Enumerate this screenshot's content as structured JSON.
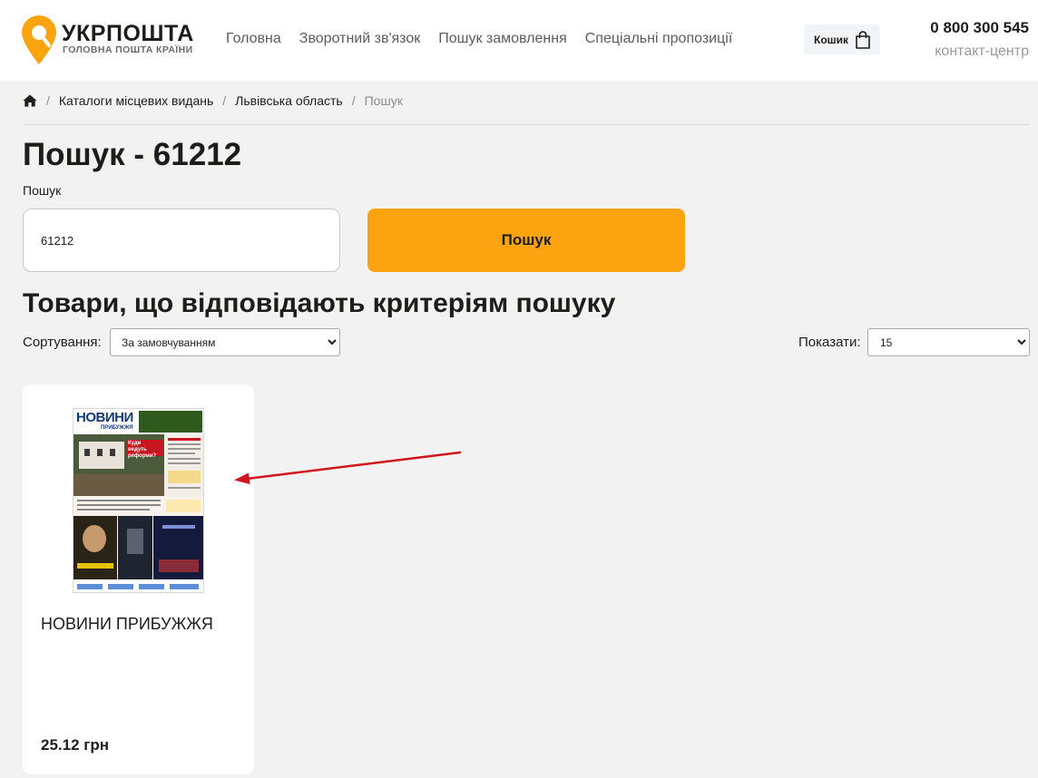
{
  "header": {
    "logo": {
      "title": "УКРПОШТА",
      "subtitle": "ГОЛОВНА ПОШТА КРАЇНИ"
    },
    "nav": [
      {
        "label": "Головна"
      },
      {
        "label": "Зворотний зв'язок"
      },
      {
        "label": "Пошук замовлення"
      },
      {
        "label": "Спеціальні пропозиції"
      }
    ],
    "cart": {
      "label": "Кошик",
      "icon": "shopping-bag-icon"
    },
    "contact": {
      "phone": "0 800 300 545",
      "label": "контакт-центр"
    }
  },
  "breadcrumb": {
    "home_icon": "home-icon",
    "items": [
      "Каталоги місцевих видань",
      "Львівська область",
      "Пошук"
    ]
  },
  "page": {
    "title": "Пошук - 61212",
    "search_label": "Пошук",
    "search_value": "61212",
    "search_button": "Пошук",
    "results_heading": "Товари, що відповідають критеріям пошуку"
  },
  "controls": {
    "sort_label": "Сортування:",
    "sort_value": "За замовчуванням",
    "show_label": "Показати:",
    "show_value": "15"
  },
  "products": [
    {
      "title": "НОВИНИ ПРИБУЖЖЯ",
      "price": "25.12 грн",
      "cover": {
        "masthead": "НОВИНИ",
        "masthead_sub": "ПРИБУЖЖЯ",
        "headline": "Куди ведуть реформи?"
      }
    }
  ],
  "colors": {
    "accent": "#fba40f",
    "background": "#f2f2f2",
    "annotation_arrow": "#d0161c"
  }
}
